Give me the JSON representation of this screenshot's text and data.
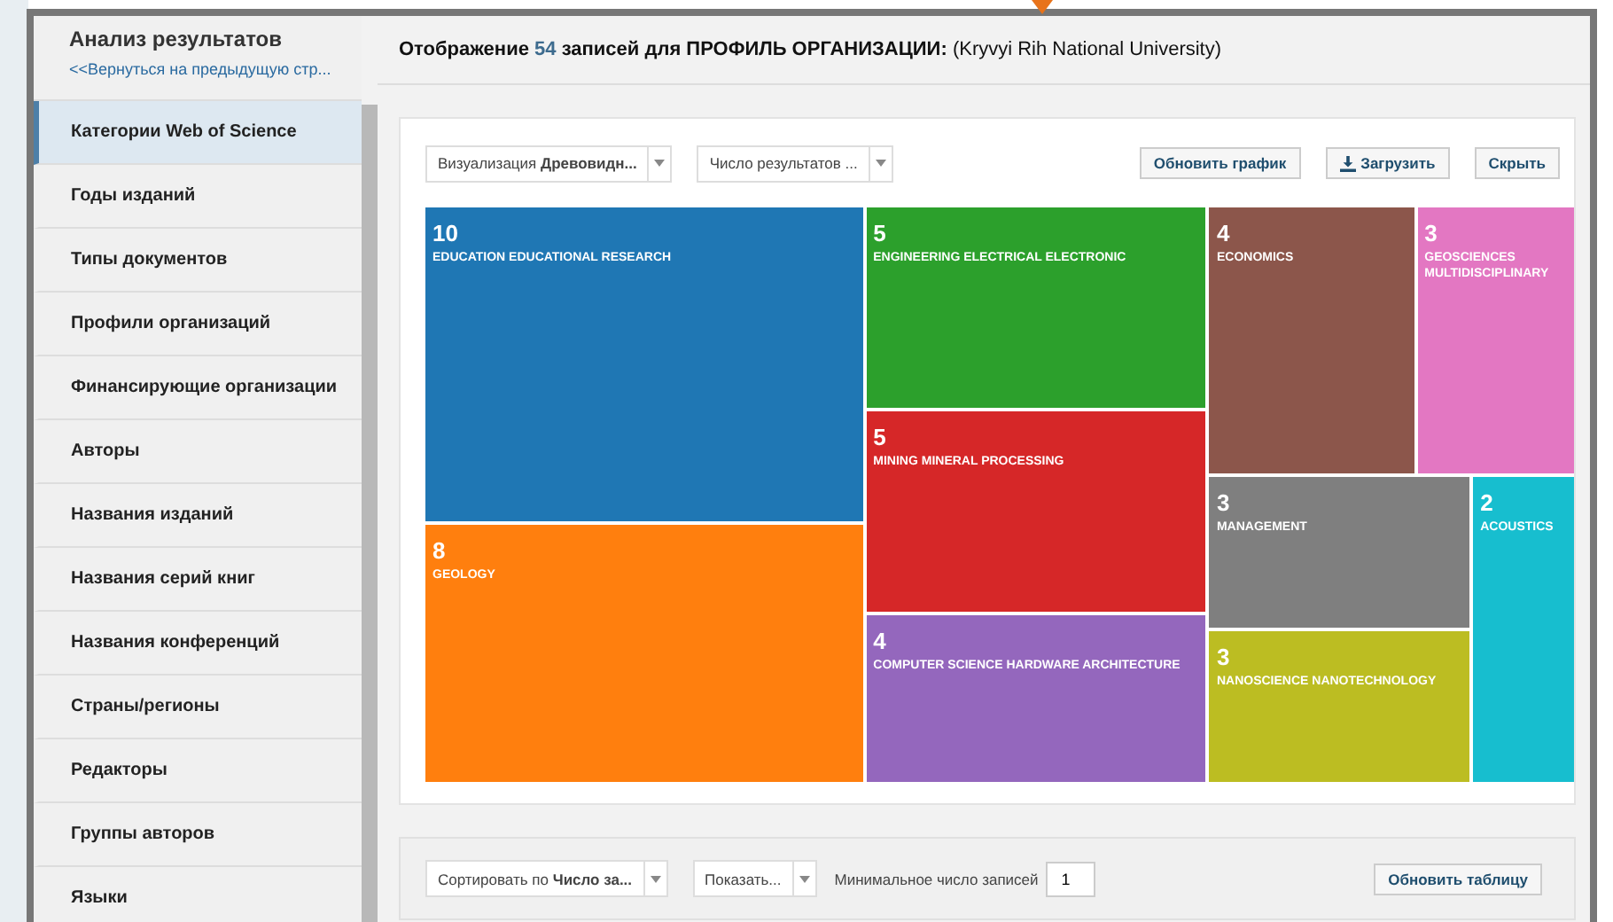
{
  "sidebar": {
    "title": "Анализ результатов",
    "back_link": "<<Вернуться на предыдущую стр...",
    "items": [
      {
        "label": "Категории Web of Science",
        "selected": true
      },
      {
        "label": "Годы изданий",
        "selected": false
      },
      {
        "label": "Типы документов",
        "selected": false
      },
      {
        "label": "Профили организаций",
        "selected": false
      },
      {
        "label": "Финансирующие организации",
        "selected": false
      },
      {
        "label": "Авторы",
        "selected": false
      },
      {
        "label": "Названия изданий",
        "selected": false
      },
      {
        "label": "Названия серий книг",
        "selected": false
      },
      {
        "label": "Названия конференций",
        "selected": false
      },
      {
        "label": "Страны/регионы",
        "selected": false
      },
      {
        "label": "Редакторы",
        "selected": false
      },
      {
        "label": "Группы авторов",
        "selected": false
      },
      {
        "label": "Языки",
        "selected": false
      }
    ]
  },
  "header": {
    "prefix": "Отображение",
    "count": "54",
    "middle": "записей для ПРОФИЛЬ ОРГАНИЗАЦИИ:",
    "subject": "(Kryvyi Rih National University)"
  },
  "chart_toolbar": {
    "visualization": {
      "label": "Визуализация",
      "value": "Древовидн..."
    },
    "results_select": "Число результатов ...",
    "buttons": [
      "Обновить график",
      "Загрузить",
      "Скрыть"
    ]
  },
  "treemap": {
    "cells": [
      {
        "value": "10",
        "label": "EDUCATION EDUCATIONAL RESEARCH",
        "color": "#1f77b4"
      },
      {
        "value": "8",
        "label": "GEOLOGY",
        "color": "#ff7f0e"
      },
      {
        "value": "5",
        "label": "ENGINEERING ELECTRICAL ELECTRONIC",
        "color": "#2ca02c"
      },
      {
        "value": "5",
        "label": "MINING MINERAL PROCESSING",
        "color": "#d62728"
      },
      {
        "value": "4",
        "label": "COMPUTER SCIENCE HARDWARE ARCHITECTURE",
        "color": "#9467bd"
      },
      {
        "value": "4",
        "label": "ECONOMICS",
        "color": "#8c564b"
      },
      {
        "value": "3",
        "label": "GEOSCIENCES MULTIDISCIPLINARY",
        "color": "#e377c2"
      },
      {
        "value": "3",
        "label": "MANAGEMENT",
        "color": "#7f7f7f"
      },
      {
        "value": "3",
        "label": "NANOSCIENCE NANOTECHNOLOGY",
        "color": "#bcbd22"
      },
      {
        "value": "2",
        "label": "ACOUSTICS",
        "color": "#17becf"
      }
    ]
  },
  "table_toolbar": {
    "sort": {
      "label": "Сортировать по",
      "value": "Число за..."
    },
    "show_select": "Показать...",
    "min_records": {
      "label": "Минимальное число записей",
      "value": "1"
    },
    "button": "Обновить таблицу"
  }
}
